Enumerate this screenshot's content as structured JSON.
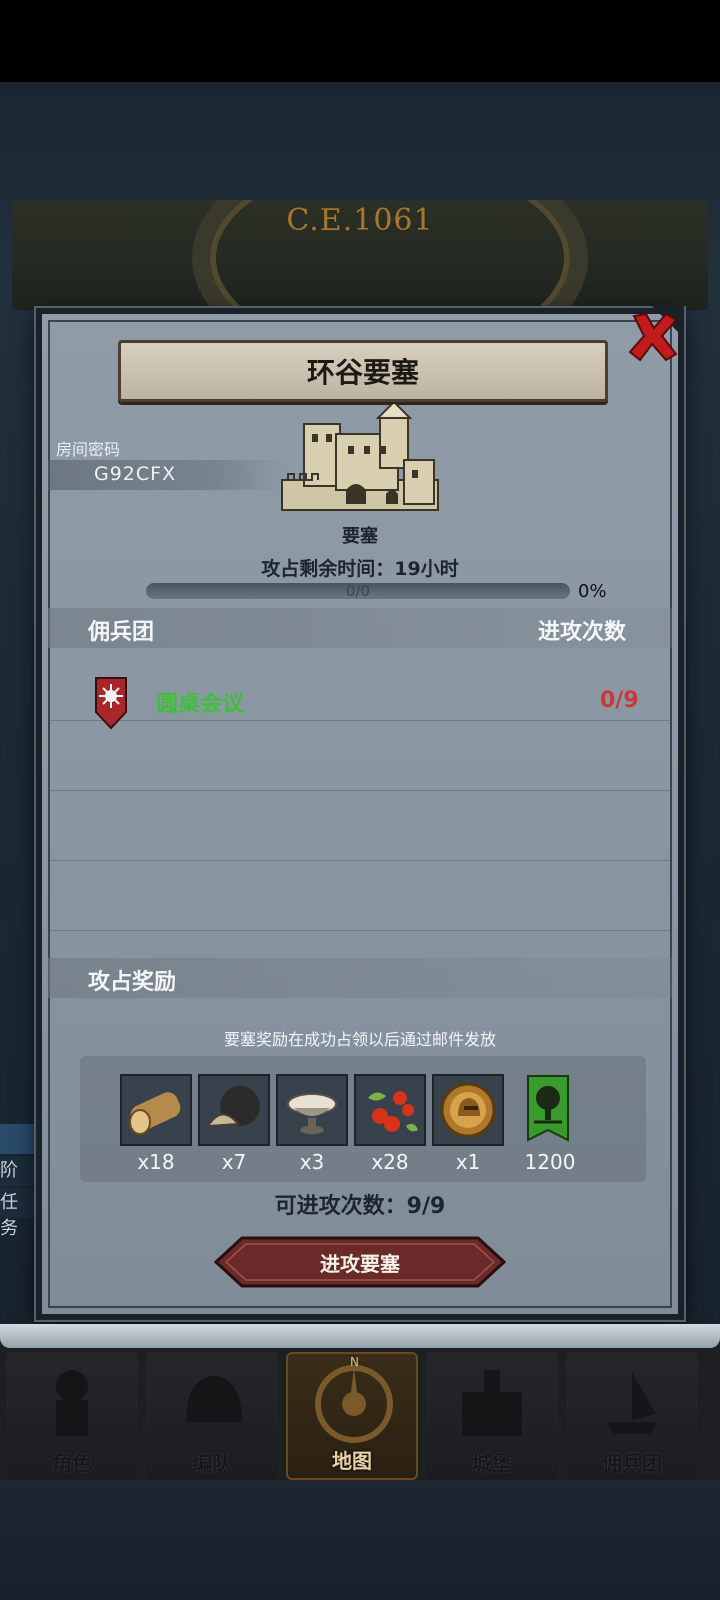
{
  "header": {
    "era": "C.E.1061"
  },
  "dialog": {
    "title": "环谷要塞",
    "room_password_label": "房间密码",
    "room_password": "G92CFX",
    "fortress_label": "要塞",
    "time_remaining_label": "攻占剩余时间：",
    "time_remaining_value": "19小时",
    "progress_text": "0/0",
    "progress_percent": "0%",
    "progress_fraction": 0,
    "mercenary_section": {
      "title": "佣兵团",
      "attack_count_header": "进攻次数"
    },
    "mercenaries": [
      {
        "name": "圆桌会议",
        "attacks": "0/9"
      }
    ],
    "reward_section": {
      "title": "攻占奖励",
      "note": "要塞奖励在成功占领以后通过邮件发放"
    },
    "rewards": [
      {
        "icon": "log-icon",
        "qty": "x18"
      },
      {
        "icon": "truffle-icon",
        "qty": "x7"
      },
      {
        "icon": "silver-bowl-icon",
        "qty": "x3"
      },
      {
        "icon": "berries-icon",
        "qty": "x28"
      },
      {
        "icon": "helmet-coin-icon",
        "qty": "x1"
      },
      {
        "icon": "tree-banner-icon",
        "qty": "1200"
      }
    ],
    "attempts_label": "可进攻次数：",
    "attempts_value": "9/9",
    "attack_button": "进攻要塞"
  },
  "side_peek": {
    "line1": "阶",
    "line2": "任务"
  },
  "nav": [
    {
      "label": "角色",
      "icon": "knight-icon"
    },
    {
      "label": "编队",
      "icon": "helmet-icon"
    },
    {
      "label": "地图",
      "icon": "compass-icon"
    },
    {
      "label": "城堡",
      "icon": "castle-icon"
    },
    {
      "label": "佣兵团",
      "icon": "ship-icon"
    }
  ],
  "colors": {
    "accent": "#3fbf3a",
    "danger": "#c73a3a",
    "button": "#6b2a2a"
  }
}
